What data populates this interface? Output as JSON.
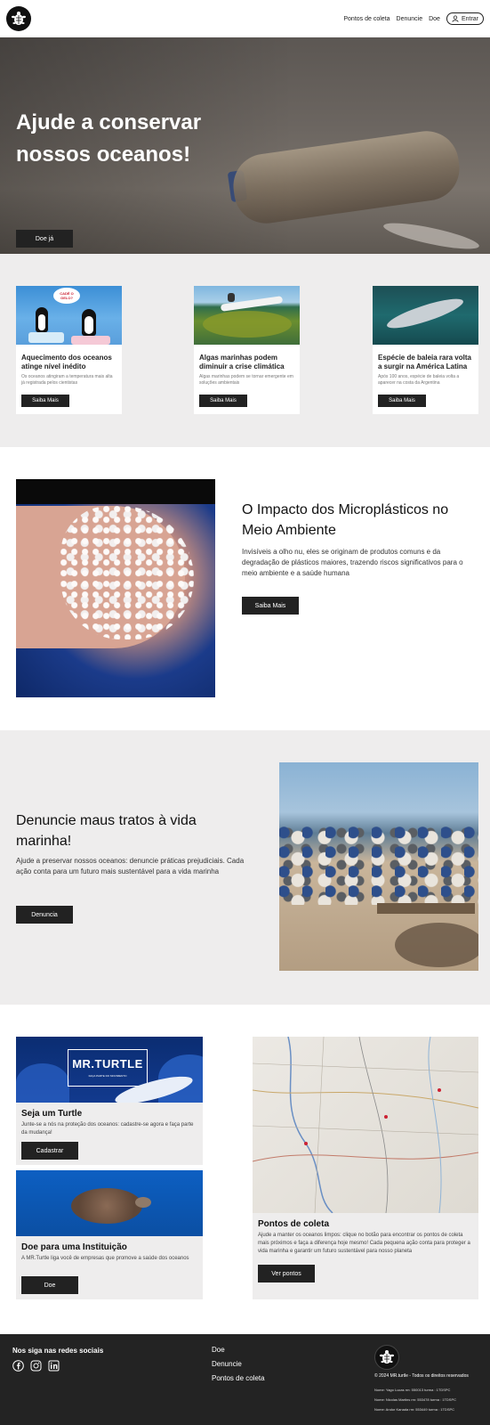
{
  "header": {
    "nav": [
      "Pontos de coleta",
      "Denuncie",
      "Doe"
    ],
    "login_label": "Entrar"
  },
  "hero": {
    "title": "Ajude a conservar nossos oceanos!",
    "cta": "Doe já"
  },
  "news": [
    {
      "title": "Aquecimento dos oceanos atinge nível inédito",
      "text": "Os oceanos atingiram a temperatura mais alta já registrada pelos cientistas",
      "button": "Saiba Mais",
      "badge": "CADÊ O GELO?"
    },
    {
      "title": "Algas marinhas podem diminuir a crise climática",
      "text": "Algas marinhas podem se tornar emergente em soluções ambientais",
      "button": "Saiba Mais"
    },
    {
      "title": "Espécie de baleia rara volta a surgir na América Latina",
      "text": "Após 100 anos, espécie de baleia volta a aparecer na costa da Argentina",
      "button": "Saiba Mais"
    }
  ],
  "micro": {
    "title": "O Impacto dos Microplásticos no Meio Ambiente",
    "text": "Invisíveis a olho nu, eles se originam de produtos comuns e da degradação de plásticos maiores, trazendo riscos significativos para o meio ambiente e a saúde humana",
    "button": "Saiba Mais"
  },
  "report": {
    "title": "Denuncie maus tratos à vida marinha!",
    "text": "Ajude a preservar nossos oceanos: denuncie práticas prejudiciais. Cada ação conta para um futuro mais sustentável para a vida marinha",
    "button": "Denuncia"
  },
  "turtle_card": {
    "banner_title": "MR.TURTLE",
    "banner_subtitle": "FAÇA PARTE DO MOVIMENTO",
    "title": "Seja um Turtle",
    "text": "Junte-se a nós na proteção dos oceanos: cadastre-se agora e faça parte da mudança!",
    "button": "Cadastrar"
  },
  "donate_card": {
    "title": "Doe para uma Instituição",
    "text": "A MR.Turtle liga você de empresas que promove a saúde dos oceanos",
    "button": "Doe"
  },
  "map_card": {
    "title": "Pontos de coleta",
    "text": "Ajude a manter os oceanos limpos: clique no botão para encontrar os pontos de coleta mais próximos e faça a diferença hoje mesmo! Cada pequena ação conta para proteger a vida marinha e garantir um futuro sustentável para nosso planeta",
    "button": "Ver pontos"
  },
  "footer": {
    "follow": "Nos siga nas redes sociais",
    "socials": [
      "facebook-icon",
      "instagram-icon",
      "linkedin-icon"
    ],
    "links": [
      "Doe",
      "Denuncie",
      "Pontos de coleta"
    ],
    "copyright": "© 2024 MR.turtle - Todos os direitos reservados",
    "credits": [
      "Nome: Yago Lucas rm: 550013 turma : 1TDSPC",
      "Nome: Nicolas Martins rm: 553478 turma : 1TDSPC",
      "Nome: Andor Kanada rm: 553449 turma : 1TDSPC"
    ]
  }
}
